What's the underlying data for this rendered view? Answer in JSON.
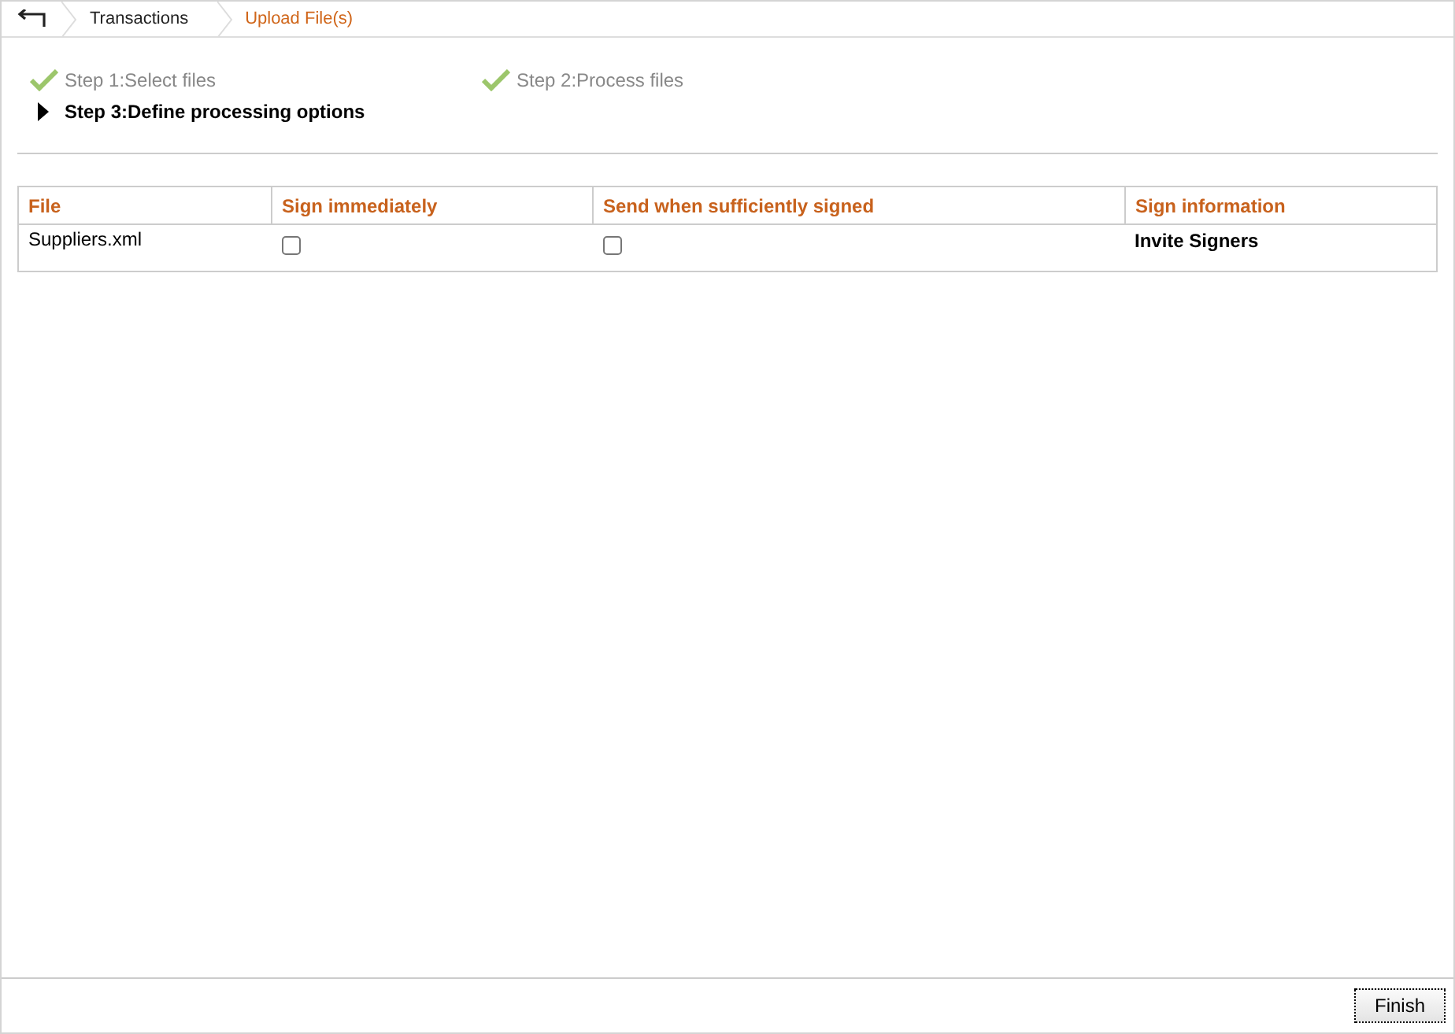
{
  "breadcrumb": [
    {
      "label": "Transactions",
      "selected": false
    },
    {
      "label": "Upload File(s)",
      "selected": true
    }
  ],
  "steps": [
    {
      "kind": "done",
      "label": "Step 1:Select files"
    },
    {
      "kind": "done",
      "label": "Step 2:Process files"
    },
    {
      "kind": "current",
      "label": "Step 3:Define processing options"
    }
  ],
  "table": {
    "columns": [
      "File",
      "Sign immediately",
      "Send when sufficiently signed",
      "Sign information"
    ],
    "rows": [
      {
        "file": "Suppliers.xml",
        "sign_immediately": false,
        "send_when_signed": false,
        "sign_information": "Invite Signers"
      }
    ]
  },
  "buttons": [
    "Finish"
  ]
}
